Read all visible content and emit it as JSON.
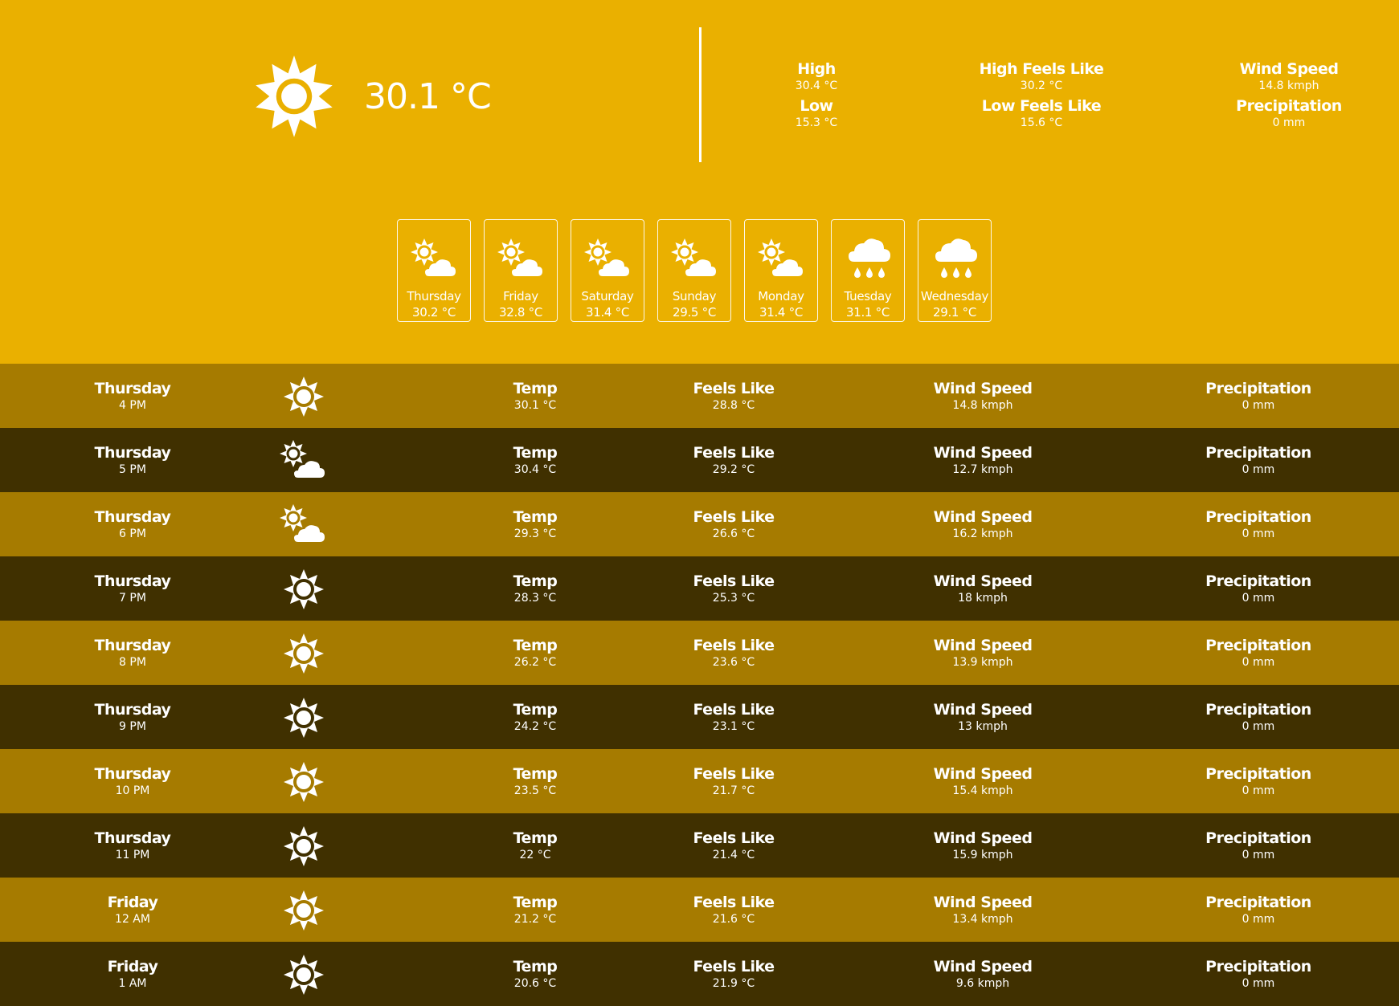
{
  "current": {
    "icon": "sun-icon",
    "temperature": "30.1 °C"
  },
  "summary": {
    "high_label": "High",
    "high_value": "30.4 °C",
    "low_label": "Low",
    "low_value": "15.3 °C",
    "high_feels_label": "High Feels Like",
    "high_feels_value": "30.2 °C",
    "low_feels_label": "Low Feels Like",
    "low_feels_value": "15.6 °C",
    "wind_label": "Wind Speed",
    "wind_value": "14.8 kmph",
    "precip_label": "Precipitation",
    "precip_value": "0 mm"
  },
  "forecast": [
    {
      "day": "Thursday",
      "temp": "30.2 °C",
      "icon": "partly-cloudy-icon"
    },
    {
      "day": "Friday",
      "temp": "32.8 °C",
      "icon": "partly-cloudy-icon"
    },
    {
      "day": "Saturday",
      "temp": "31.4 °C",
      "icon": "partly-cloudy-icon"
    },
    {
      "day": "Sunday",
      "temp": "29.5 °C",
      "icon": "partly-cloudy-icon"
    },
    {
      "day": "Monday",
      "temp": "31.4 °C",
      "icon": "partly-cloudy-icon"
    },
    {
      "day": "Tuesday",
      "temp": "31.1 °C",
      "icon": "rain-cloud-icon"
    },
    {
      "day": "Wednesday",
      "temp": "29.1 °C",
      "icon": "rain-cloud-icon"
    }
  ],
  "hourly_labels": {
    "temp": "Temp",
    "feels": "Feels Like",
    "wind": "Wind Speed",
    "precip": "Precipitation"
  },
  "hourly": [
    {
      "day": "Thursday",
      "time": "4 PM",
      "icon": "sun-icon",
      "temp": "30.1 °C",
      "feels": "28.8 °C",
      "wind": "14.8 kmph",
      "precip": "0 mm"
    },
    {
      "day": "Thursday",
      "time": "5 PM",
      "icon": "partly-cloudy-icon",
      "temp": "30.4 °C",
      "feels": "29.2 °C",
      "wind": "12.7 kmph",
      "precip": "0 mm"
    },
    {
      "day": "Thursday",
      "time": "6 PM",
      "icon": "partly-cloudy-icon",
      "temp": "29.3 °C",
      "feels": "26.6 °C",
      "wind": "16.2 kmph",
      "precip": "0 mm"
    },
    {
      "day": "Thursday",
      "time": "7 PM",
      "icon": "sun-icon",
      "temp": "28.3 °C",
      "feels": "25.3 °C",
      "wind": "18 kmph",
      "precip": "0 mm"
    },
    {
      "day": "Thursday",
      "time": "8 PM",
      "icon": "sun-icon",
      "temp": "26.2 °C",
      "feels": "23.6 °C",
      "wind": "13.9 kmph",
      "precip": "0 mm"
    },
    {
      "day": "Thursday",
      "time": "9 PM",
      "icon": "sun-icon",
      "temp": "24.2 °C",
      "feels": "23.1 °C",
      "wind": "13 kmph",
      "precip": "0 mm"
    },
    {
      "day": "Thursday",
      "time": "10 PM",
      "icon": "sun-icon",
      "temp": "23.5 °C",
      "feels": "21.7 °C",
      "wind": "15.4 kmph",
      "precip": "0 mm"
    },
    {
      "day": "Thursday",
      "time": "11 PM",
      "icon": "sun-icon",
      "temp": "22 °C",
      "feels": "21.4 °C",
      "wind": "15.9 kmph",
      "precip": "0 mm"
    },
    {
      "day": "Friday",
      "time": "12 AM",
      "icon": "sun-icon",
      "temp": "21.2 °C",
      "feels": "21.6 °C",
      "wind": "13.4 kmph",
      "precip": "0 mm"
    },
    {
      "day": "Friday",
      "time": "1 AM",
      "icon": "sun-icon",
      "temp": "20.6 °C",
      "feels": "21.9 °C",
      "wind": "9.6 kmph",
      "precip": "0 mm"
    }
  ],
  "colors": {
    "hero_bg": "#EAB000",
    "row_light": "#A67B00",
    "row_dark": "#403000",
    "text": "#FFFFFF"
  }
}
